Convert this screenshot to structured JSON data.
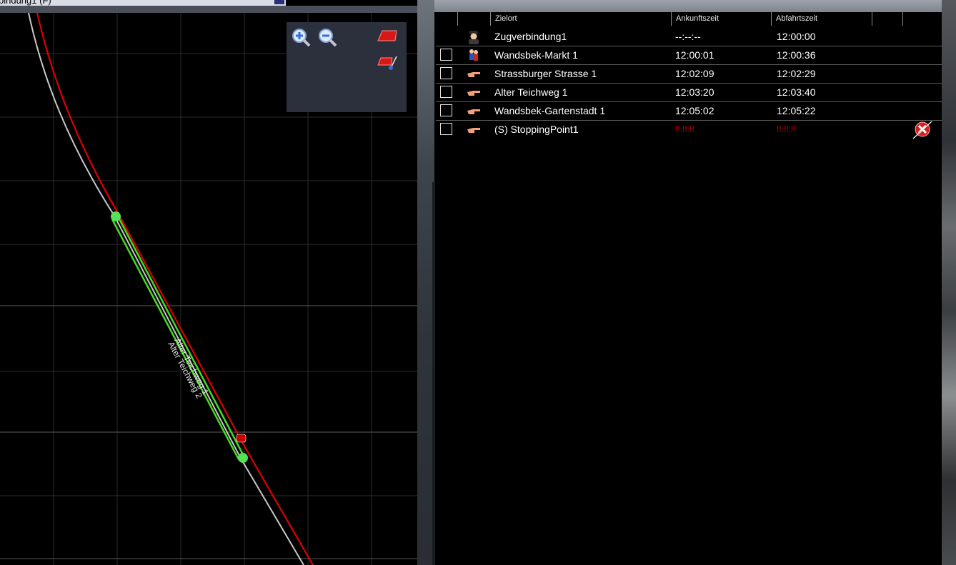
{
  "window": {
    "title_fragment": "bindung1 (F)",
    "background_colors": {
      "map": "#000000",
      "grid": "#3a3a3a",
      "panel": "#2b303c"
    }
  },
  "map": {
    "tools": {
      "zoom_in_icon": "zoom-in-icon",
      "zoom_out_icon": "zoom-out-icon",
      "track_tool_icon": "track-segment-icon",
      "edit_track_icon": "edit-track-icon"
    },
    "labels": {
      "track_1": "Alter Teichweg 1",
      "track_2": "Alter Teichweg 2"
    },
    "colors": {
      "active_track": "#e00000",
      "inactive_track": "#c8c8c8",
      "platform": "#44dd22",
      "marker": "#55e055"
    }
  },
  "timetable": {
    "columns": [
      "Zielort",
      "Ankunftszeit",
      "Abfahrtszeit",
      "",
      ""
    ],
    "rows": [
      {
        "checkbox": false,
        "icon": "driver-icon",
        "destination": "Zugverbindung1",
        "arrival": "--:--:--",
        "departure": "12:00:00"
      },
      {
        "checkbox": true,
        "icon": "passengers-icon",
        "destination": "Wandsbek-Markt 1",
        "arrival": "12:00:01",
        "departure": "12:00:36"
      },
      {
        "checkbox": true,
        "icon": "pointing-hand-icon",
        "destination": "Strassburger Strasse 1",
        "arrival": "12:02:09",
        "departure": "12:02:29"
      },
      {
        "checkbox": true,
        "icon": "pointing-hand-icon",
        "destination": "Alter Teichweg 1",
        "arrival": "12:03:20",
        "departure": "12:03:40"
      },
      {
        "checkbox": true,
        "icon": "pointing-hand-icon",
        "destination": "Wandsbek-Gartenstadt 1",
        "arrival": "12:05:02",
        "departure": "12:05:22"
      },
      {
        "checkbox": true,
        "icon": "pointing-hand-icon",
        "destination": "(S) StoppingPoint1",
        "arrival": "!!:!!:!!",
        "departure": "!!:!!:!!",
        "delete_icon": "delete-icon",
        "error_color": "#e00000"
      }
    ]
  }
}
